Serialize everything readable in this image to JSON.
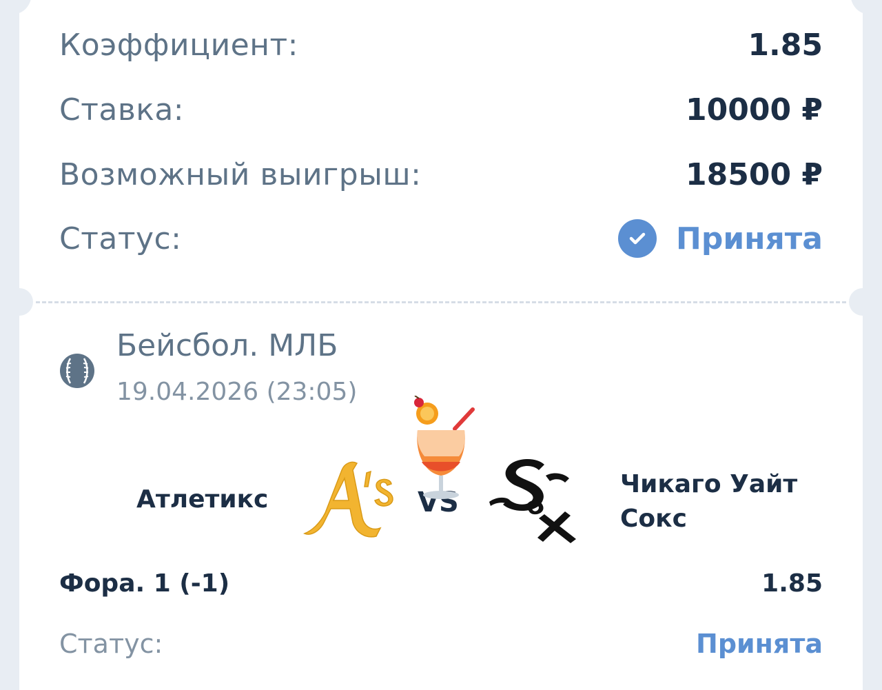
{
  "summary": {
    "odds_label": "Коэффициент:",
    "odds_value": "1.85",
    "stake_label": "Ставка:",
    "stake_value": "10000 ₽",
    "win_label": "Возможный выигрыш:",
    "win_value": "18500 ₽",
    "status_label": "Статус:",
    "status_value": "Принята"
  },
  "event": {
    "league": "Бейсбол. МЛБ",
    "datetime": "19.04.2026 (23:05)",
    "home_team": "Атлетикс",
    "away_team": "Чикаго Уайт Сокс",
    "vs": "VS",
    "bet_type": "Фора. 1 (-1)",
    "bet_odds": "1.85",
    "status_label": "Статус:",
    "status_value": "Принята"
  },
  "icons": {
    "status": "check-circle-icon",
    "league": "baseball-icon",
    "home_logo": "athletics-logo",
    "away_logo": "white-sox-logo",
    "sticker": "cocktail-emoji"
  },
  "colors": {
    "accent": "#5b8fd2",
    "text_dark": "#1c2e45",
    "text_muted": "#5e7387"
  }
}
